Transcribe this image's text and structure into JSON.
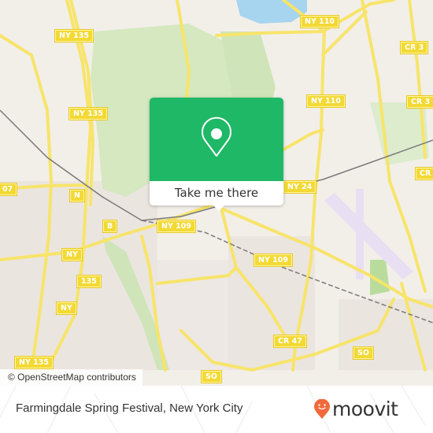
{
  "map": {
    "attribution": "© OpenStreetMap contributors",
    "road_labels": [
      {
        "id": "ny135-top",
        "text": "NY 135"
      },
      {
        "id": "ny135-mid",
        "text": "NY 135"
      },
      {
        "id": "ny110-top",
        "text": "NY 110"
      },
      {
        "id": "ny110-mid",
        "text": "NY 110"
      },
      {
        "id": "cr3-top",
        "text": "CR 3"
      },
      {
        "id": "cr3-mid",
        "text": "CR 3"
      },
      {
        "id": "cr-right",
        "text": "CR"
      },
      {
        "id": "ny24",
        "text": "NY 24"
      },
      {
        "id": "ny107",
        "text": "07"
      },
      {
        "id": "n-partial",
        "text": "N"
      },
      {
        "id": "b",
        "text": "B"
      },
      {
        "id": "ny109-left",
        "text": "NY 109"
      },
      {
        "id": "ny109-right",
        "text": "NY 109"
      },
      {
        "id": "ny-partial",
        "text": "NY"
      },
      {
        "id": "ny135-partial",
        "text": "135"
      },
      {
        "id": "ny-partial-2",
        "text": "NY"
      },
      {
        "id": "ny135-bottom",
        "text": "NY 135"
      },
      {
        "id": "cr47",
        "text": "CR 47"
      },
      {
        "id": "so-right",
        "text": "SO"
      },
      {
        "id": "so-bottom",
        "text": "SO"
      }
    ],
    "colors": {
      "land": "#f2efe9",
      "road": "#f7e46a",
      "park": "#d5e8c0",
      "water": "#a7d4ee",
      "railway": "#7a7a7a",
      "airport": "#e8dff2"
    }
  },
  "popup": {
    "icon": "location-pin-icon",
    "button_label": "Take me there",
    "color": "#1fb866"
  },
  "footer": {
    "title": "Farmingdale Spring Festival, New York City",
    "logo_text": "moovit",
    "logo_color": "#f06a3c"
  }
}
